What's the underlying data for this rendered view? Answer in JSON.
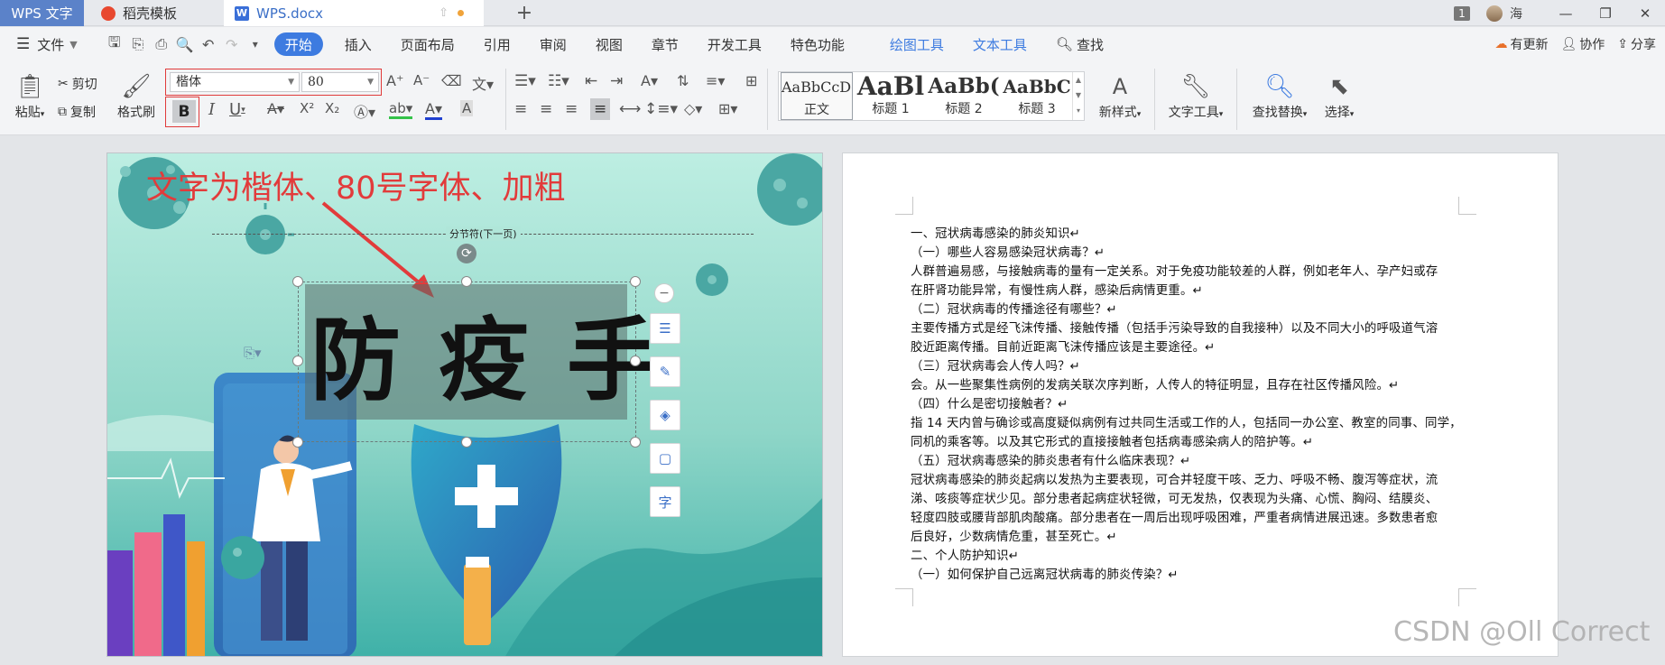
{
  "tabs": {
    "app": "WPS 文字",
    "template": "稻壳模板",
    "doc": "WPS.docx",
    "add": "+"
  },
  "titlebar_right": {
    "badge": "1",
    "user": "海",
    "minimize": "—",
    "restore": "❐",
    "close": "✕"
  },
  "menubar": {
    "file": "文件",
    "items": [
      "开始",
      "插入",
      "页面布局",
      "引用",
      "审阅",
      "视图",
      "章节",
      "开发工具",
      "特色功能"
    ],
    "tool_items": [
      "绘图工具",
      "文本工具"
    ],
    "search": "查找",
    "right": [
      "有更新",
      "协作",
      "分享"
    ]
  },
  "ribbon": {
    "paste": "粘贴",
    "cut": "剪切",
    "copy": "复制",
    "format_painter": "格式刷",
    "font_name": "楷体",
    "font_size": "80",
    "bold": "B",
    "italic": "I",
    "underline": "U",
    "styles": [
      {
        "preview": "AaBbCcDd",
        "name": "正文"
      },
      {
        "preview": "AaBl",
        "name": "标题 1"
      },
      {
        "preview": "AaBb(",
        "name": "标题 2"
      },
      {
        "preview": "AaBbC",
        "name": "标题 3"
      }
    ],
    "new_style": "新样式",
    "text_tools": "文字工具",
    "find_replace": "查找替换",
    "select": "选择"
  },
  "left_page": {
    "annotation": "文字为楷体、80号字体、加粗",
    "section_break": "分节符(下一页)",
    "textbox_text": "防疫手"
  },
  "right_page": {
    "lines": [
      "一、冠状病毒感染的肺炎知识↵",
      "（一）哪些人容易感染冠状病毒？↵",
      "人群普遍易感，与接触病毒的量有一定关系。对于免疫功能较差的人群，例如老年人、孕产妇或存",
      "在肝肾功能异常，有慢性病人群，感染后病情更重。↵",
      "（二）冠状病毒的传播途径有哪些？↵",
      "主要传播方式是经飞沫传播、接触传播（包括手污染导致的自我接种）以及不同大小的呼吸道气溶",
      "胶近距离传播。目前近距离飞沫传播应该是主要途径。↵",
      "（三）冠状病毒会人传人吗？↵",
      "会。从一些聚集性病例的发病关联次序判断，人传人的特征明显，且存在社区传播风险。↵",
      "（四）什么是密切接触者？↵",
      "指 14 天内曾与确诊或高度疑似病例有过共同生活或工作的人，包括同一办公室、教室的同事、同学，",
      "同机的乘客等。以及其它形式的直接接触者包括病毒感染病人的陪护等。↵",
      "（五）冠状病毒感染的肺炎患者有什么临床表现？↵",
      "冠状病毒感染的肺炎起病以发热为主要表现，可合并轻度干咳、乏力、呼吸不畅、腹泻等症状，流",
      "涕、咳痰等症状少见。部分患者起病症状轻微，可无发热，仅表现为头痛、心慌、胸闷、结膜炎、",
      "轻度四肢或腰背部肌肉酸痛。部分患者在一周后出现呼吸困难，严重者病情进展迅速。多数患者愈",
      "后良好，少数病情危重，甚至死亡。↵",
      "二、个人防护知识↵",
      "（一）如何保护自己远离冠状病毒的肺炎传染？↵"
    ]
  },
  "watermark": "CSDN @Oll Correct"
}
